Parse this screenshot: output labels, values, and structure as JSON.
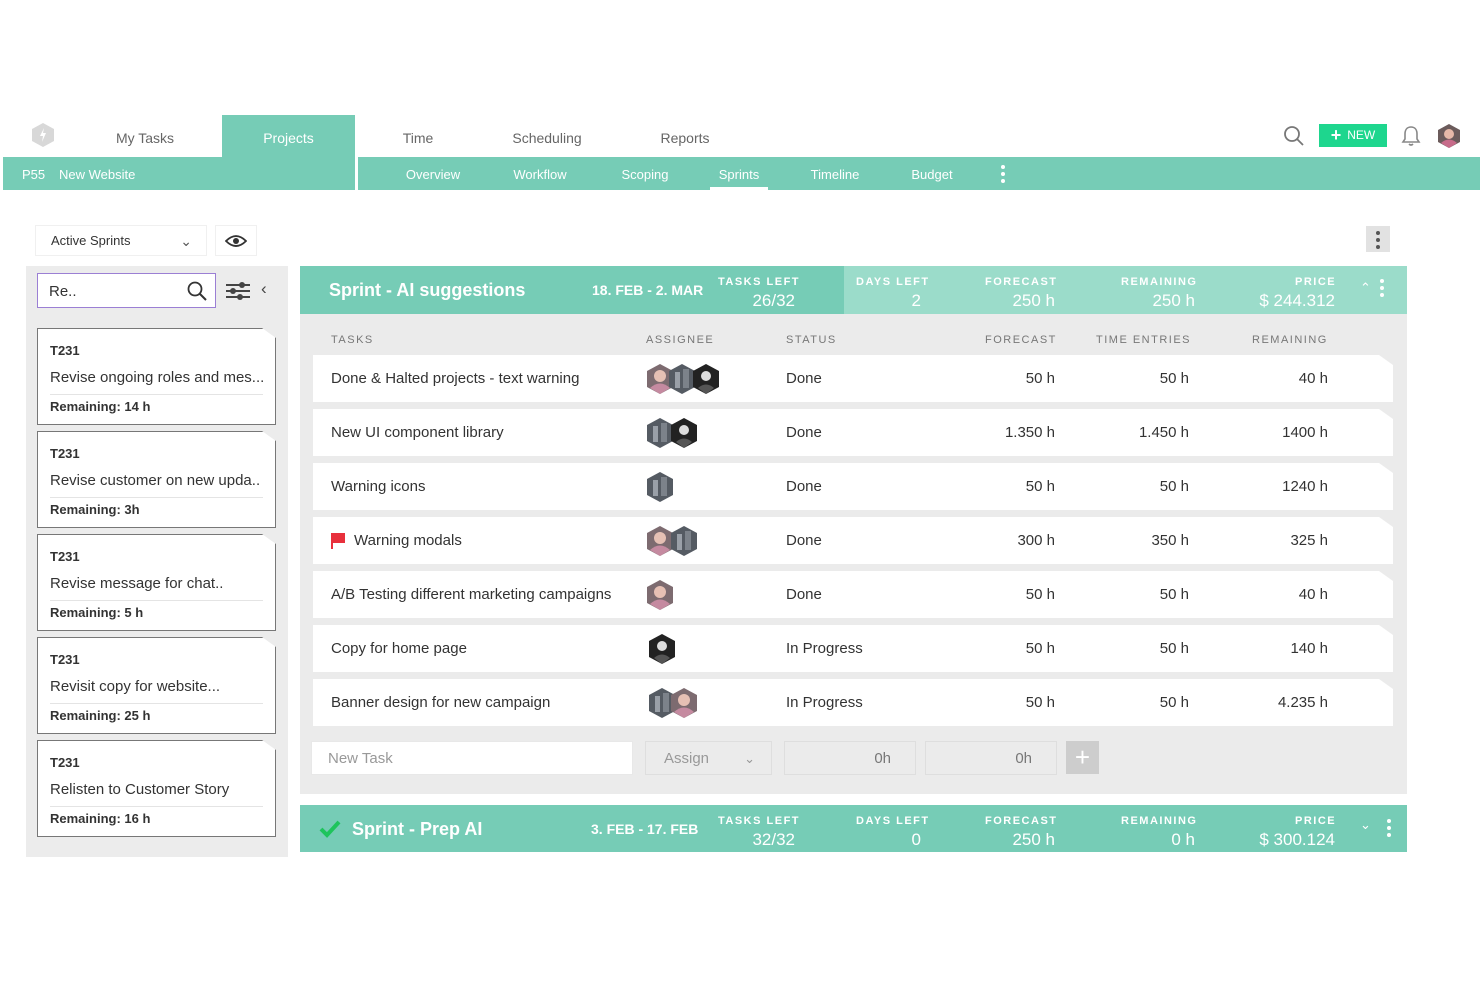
{
  "nav": {
    "items": [
      "My Tasks",
      "Projects",
      "Time",
      "Scheduling",
      "Reports"
    ],
    "new_label": "NEW"
  },
  "project": {
    "code": "P55",
    "name": "New Website"
  },
  "subnav": {
    "tabs": [
      "Overview",
      "Workflow",
      "Scoping",
      "Sprints",
      "Timeline",
      "Budget"
    ],
    "active": "Sprints"
  },
  "filter": {
    "selected": "Active Sprints"
  },
  "backlog": {
    "search_value": "Re..",
    "cards": [
      {
        "code": "T231",
        "title": "Revise ongoing roles and mes...",
        "remaining": "Remaining: 14 h"
      },
      {
        "code": "T231",
        "title": "Revise customer on new upda..",
        "remaining": "Remaining: 3h"
      },
      {
        "code": "T231",
        "title": "Revise message for chat..",
        "remaining": "Remaining: 5 h"
      },
      {
        "code": "T231",
        "title": "Revisit copy for website...",
        "remaining": "Remaining: 25 h"
      },
      {
        "code": "T231",
        "title": "Relisten to Customer Story",
        "remaining": "Remaining: 16 h"
      }
    ]
  },
  "sprint1": {
    "title": "Sprint - AI suggestions",
    "dates": "18. FEB - 2. MAR",
    "stats": {
      "tasks_left_label": "TASKS LEFT",
      "tasks_left": "26/32",
      "days_left_label": "DAYS LEFT",
      "days_left": "2",
      "forecast_label": "FORECAST",
      "forecast": "250 h",
      "remaining_label": "REMAINING",
      "remaining": "250 h",
      "price_label": "PRICE",
      "price": "$ 244.312"
    },
    "columns": {
      "tasks": "TASKS",
      "assignee": "ASSIGNEE",
      "status": "STATUS",
      "forecast": "FORECAST",
      "time_entries": "TIME ENTRIES",
      "remaining": "REMAINING"
    },
    "rows": [
      {
        "task": "Done & Halted projects - text warning",
        "status": "Done",
        "forecast": "50 h",
        "time": "50 h",
        "remaining": "40 h"
      },
      {
        "task": "New UI component library",
        "status": "Done",
        "forecast": "1.350 h",
        "time": "1.450 h",
        "remaining": "1400 h"
      },
      {
        "task": "Warning icons",
        "status": "Done",
        "forecast": "50 h",
        "time": "50 h",
        "remaining": "1240 h"
      },
      {
        "task": "Warning modals",
        "status": "Done",
        "forecast": "300 h",
        "time": "350 h",
        "remaining": "325 h"
      },
      {
        "task": "A/B Testing different marketing campaigns",
        "status": "Done",
        "forecast": "50 h",
        "time": "50 h",
        "remaining": "40 h"
      },
      {
        "task": "Copy for home page",
        "status": "In Progress",
        "forecast": "50 h",
        "time": "50 h",
        "remaining": "140 h"
      },
      {
        "task": "Banner design for new campaign",
        "status": "In Progress",
        "forecast": "50 h",
        "time": "50 h",
        "remaining": "4.235 h"
      }
    ],
    "new_task": {
      "placeholder": "New Task",
      "assign": "Assign",
      "forecast": "0h",
      "time": "0h"
    }
  },
  "sprint2": {
    "title": "Sprint - Prep AI",
    "dates": "3. FEB - 17. FEB",
    "stats": {
      "tasks_left_label": "TASKS LEFT",
      "tasks_left": "32/32",
      "days_left_label": "DAYS LEFT",
      "days_left": "0",
      "forecast_label": "FORECAST",
      "forecast": "250 h",
      "remaining_label": "REMAINING",
      "remaining": "0 h",
      "price_label": "PRICE",
      "price": "$ 300.124"
    }
  },
  "colors": {
    "accent": "#76ccb6",
    "accent_light": "#9bdcca",
    "new_button": "#1ed68e",
    "flag": "#e8303c",
    "check": "#1ec45c"
  },
  "icons": [
    "logo-icon",
    "search-icon",
    "plus-icon",
    "bell-icon",
    "eye-icon",
    "chevron-down-icon",
    "filter-icon",
    "chevron-left-icon",
    "flag-icon",
    "check-icon",
    "kebab-icon",
    "chevron-up-icon"
  ]
}
